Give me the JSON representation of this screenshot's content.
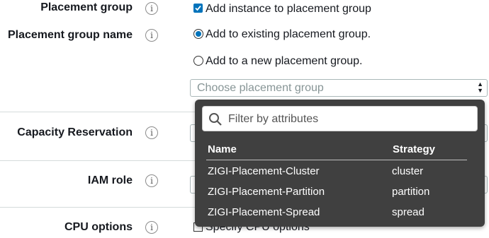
{
  "form": {
    "placement_group": {
      "label": "Placement group",
      "checkbox_label": "Add instance to placement group",
      "checked": true
    },
    "placement_group_name": {
      "label": "Placement group name",
      "radio_existing": "Add to existing placement group.",
      "radio_new": "Add to a new placement group.",
      "selected": "existing",
      "select_placeholder": "Choose placement group"
    },
    "capacity_reservation": {
      "label": "Capacity Reservation"
    },
    "iam_role": {
      "label": "IAM role"
    },
    "cpu_options": {
      "label": "CPU options",
      "checkbox_label": "Specify CPU options",
      "checked": false
    }
  },
  "dropdown": {
    "filter_placeholder": "Filter by attributes",
    "columns": [
      "Name",
      "Strategy"
    ],
    "rows": [
      {
        "name": "ZIGI-Placement-Cluster",
        "strategy": "cluster"
      },
      {
        "name": "ZIGI-Placement-Partition",
        "strategy": "partition"
      },
      {
        "name": "ZIGI-Placement-Spread",
        "strategy": "spread"
      }
    ]
  },
  "icons": {
    "info": "info-icon",
    "search": "search-icon",
    "select_arrows": "select-arrows-icon"
  },
  "colors": {
    "accent": "#0073bb",
    "dropdown_bg": "#404040",
    "divider": "#d5dbdb"
  }
}
